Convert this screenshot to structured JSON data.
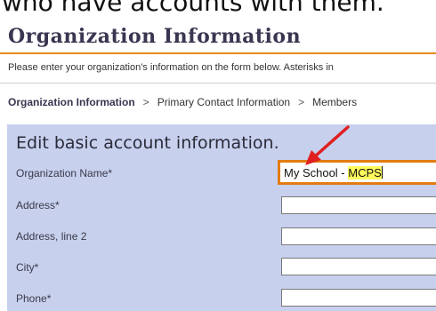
{
  "header": {
    "top_text": "who have accounts with them.",
    "title": "Organization Information"
  },
  "instructions": "Please enter your organization's information on the form below. Asterisks in",
  "breadcrumb": {
    "items": [
      "Organization Information",
      "Primary Contact Information",
      "Members"
    ],
    "separator": ">"
  },
  "form": {
    "title": "Edit basic account information.",
    "org_name": {
      "label": "Organization Name*",
      "value_prefix": "My School - ",
      "value_highlight": "MCPS"
    },
    "address": {
      "label": "Address*"
    },
    "address2": {
      "label": "Address, line 2"
    },
    "city": {
      "label": "City*"
    },
    "phone": {
      "label": "Phone*"
    }
  },
  "colors": {
    "accent_orange": "#e88a1d",
    "panel_blue": "#c7d0ed",
    "highlight_yellow": "#fffb5c",
    "arrow_red": "#e02020"
  }
}
